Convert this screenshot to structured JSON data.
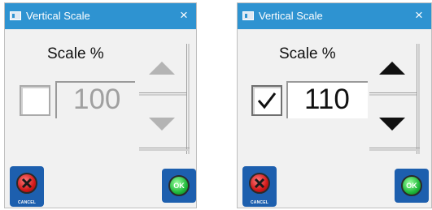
{
  "left_dialog": {
    "title": "Vertical Scale",
    "close_symbol": "×",
    "scale_label": "Scale %",
    "checked": false,
    "value": "100",
    "enabled": false,
    "cancel_caption": "CANCEL",
    "ok_text": "OK",
    "icons": [
      "app-icon",
      "close-icon",
      "spin-up-icon",
      "spin-down-icon",
      "cancel-x-icon",
      "ok-icon"
    ]
  },
  "right_dialog": {
    "title": "Vertical Scale",
    "close_symbol": "×",
    "scale_label": "Scale %",
    "checked": true,
    "value": "110",
    "enabled": true,
    "cancel_caption": "CANCEL",
    "ok_text": "OK",
    "icons": [
      "app-icon",
      "close-icon",
      "checkmark-icon",
      "spin-up-icon",
      "spin-down-icon",
      "cancel-x-icon",
      "ok-icon"
    ]
  },
  "colors": {
    "titlebar": "#2e93d1",
    "button_bg": "#1d5fae",
    "cancel_red": "#d11818",
    "ok_green": "#1fb83a",
    "disabled_gray": "#a0a0a0"
  }
}
